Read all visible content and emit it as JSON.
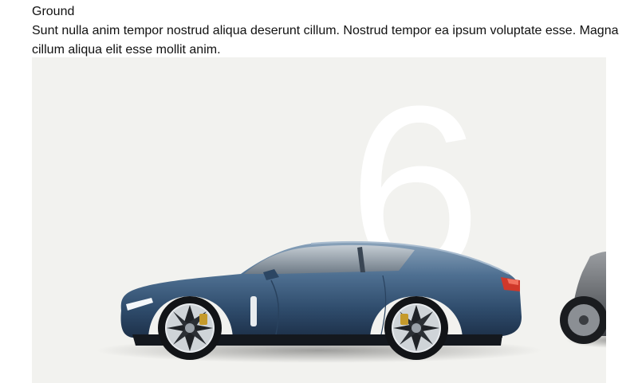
{
  "content": {
    "heading": "Ground",
    "body": "Sunt nulla anim tempor nostrud aliqua deserunt cillum. Nostrud tempor ea ipsum voluptate esse. Magna cillum aliqua elit esse mollit anim."
  },
  "hero": {
    "big_numeral": "6",
    "background_color": "#f2f2ef",
    "main_car_color": "#3d5d7e",
    "second_car_color": "#5a5d61",
    "image_description_icon": "car-image"
  }
}
